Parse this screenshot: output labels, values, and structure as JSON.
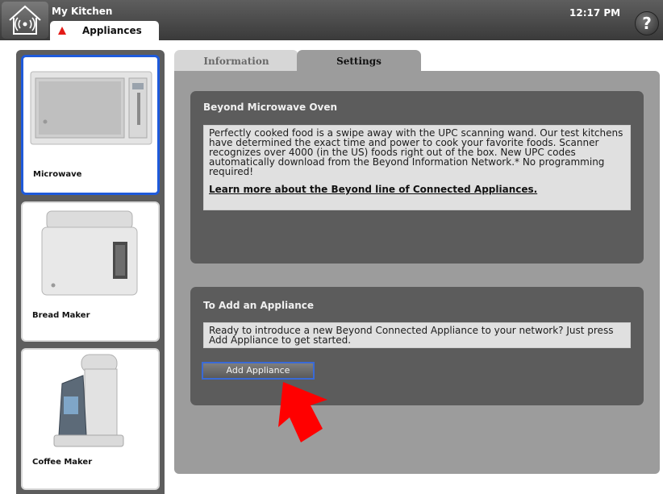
{
  "header": {
    "app_title": "My Kitchen",
    "active_tab": "Appliances",
    "time": "12:17 PM",
    "help_label": "?"
  },
  "sidebar": {
    "items": [
      {
        "label": "Microwave",
        "selected": true,
        "icon": "microwave-image"
      },
      {
        "label": "Bread Maker",
        "selected": false,
        "icon": "bread-maker-image"
      },
      {
        "label": "Coffee Maker",
        "selected": false,
        "icon": "coffee-maker-image"
      }
    ]
  },
  "tabs": [
    {
      "label": "Information",
      "active": false
    },
    {
      "label": "Settings",
      "active": true
    }
  ],
  "product_section": {
    "title": "Beyond Microwave Oven",
    "description": "Perfectly cooked food is a swipe away with the UPC scanning wand. Our test kitchens have determined the exact time and power to cook your favorite foods. Scanner recognizes over 4000 (in the US) foods right out of the box. New UPC codes automatically download from the Beyond Information Network.* No programming required!",
    "link_text": "Learn more about the Beyond line of Connected Appliances."
  },
  "add_section": {
    "title": "To Add an Appliance",
    "description": "Ready to introduce a new Beyond Connected Appliance to your network? Just press Add Appliance to get started.",
    "button_label": "Add Appliance"
  },
  "colors": {
    "selected_border": "#1e5adb",
    "alert_triangle": "#e41b17",
    "pointer_arrow": "#ff0000"
  }
}
